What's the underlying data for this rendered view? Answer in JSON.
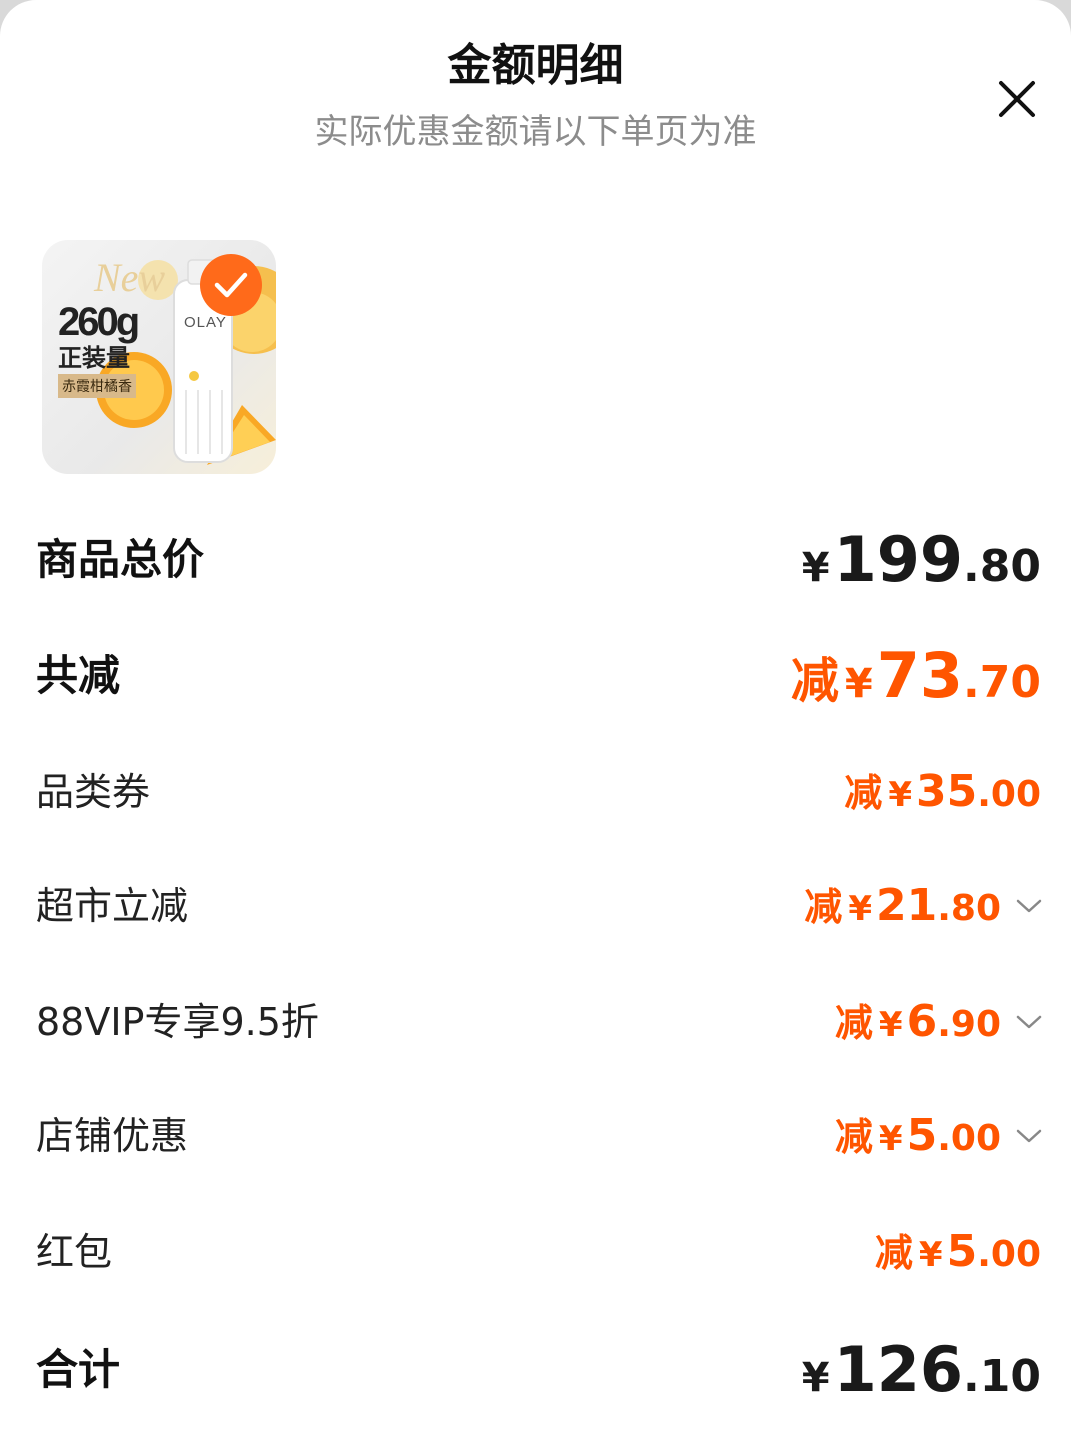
{
  "header": {
    "title": "金额明细",
    "subtitle": "实际优惠金额请以下单页为准"
  },
  "product": {
    "image_alt": "OLAY 260g 正装量 赤霞柑橘香",
    "badge_new": "New",
    "badge_weight": "260g",
    "badge_full": "正装量",
    "badge_scent": "赤霞柑橘香",
    "brand": "OLAY",
    "selected": true
  },
  "summary": {
    "total": {
      "label": "商品总价",
      "currency": "¥",
      "int": "199",
      "dec": ".80"
    },
    "reduction": {
      "label": "共减",
      "prefix": "减",
      "currency": "¥",
      "int": "73",
      "dec": ".70"
    },
    "items": [
      {
        "label": "品类券",
        "prefix": "减",
        "currency": "¥",
        "int": "35",
        "dec": ".00",
        "expandable": false
      },
      {
        "label": "超市立减",
        "prefix": "减",
        "currency": "¥",
        "int": "21",
        "dec": ".80",
        "expandable": true
      },
      {
        "label": "88VIP专享9.5折",
        "prefix": "减",
        "currency": "¥",
        "int": "6",
        "dec": ".90",
        "expandable": true
      },
      {
        "label": "店铺优惠",
        "prefix": "减",
        "currency": "¥",
        "int": "5",
        "dec": ".00",
        "expandable": true
      },
      {
        "label": "红包",
        "prefix": "减",
        "currency": "¥",
        "int": "5",
        "dec": ".00",
        "expandable": false
      }
    ],
    "grand_total": {
      "label": "合计",
      "currency": "¥",
      "int": "126",
      "dec": ".10"
    }
  },
  "colors": {
    "accent": "#ff5500",
    "check": "#ff6a1a",
    "subtitle": "#8c8c8c"
  },
  "icons": {
    "close": "close-icon",
    "check": "check-icon",
    "expand": "chevron-down-icon"
  }
}
